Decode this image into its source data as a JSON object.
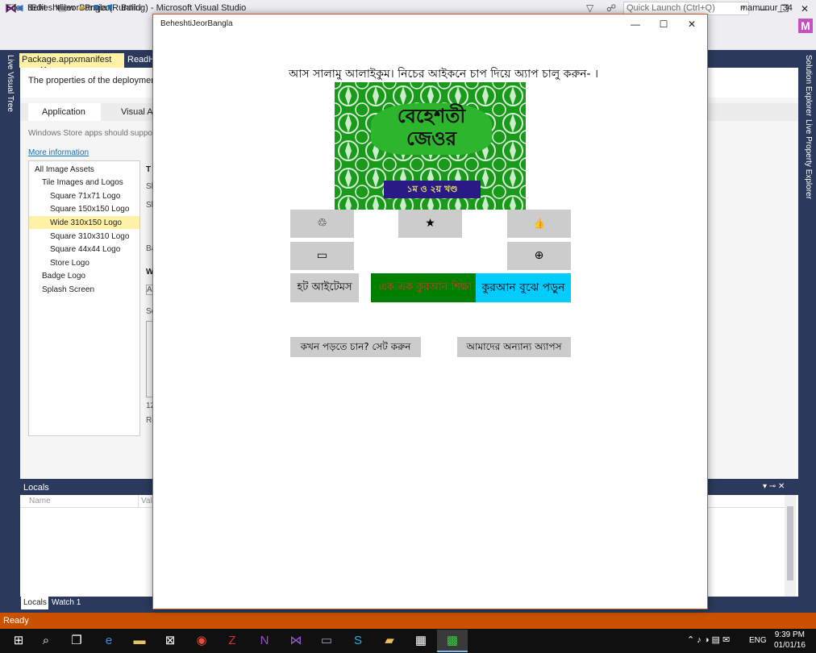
{
  "vs": {
    "title": "BeheshtiJeorBangla (Running) - Microsoft Visual Studio",
    "quick_launch_placeholder": "Quick Launch (Ctrl+Q)",
    "user": "mamunur_34",
    "avatar_letter": "M",
    "menu": [
      "File",
      "Edit",
      "View",
      "Project",
      "Build"
    ],
    "status": "Ready",
    "left_rail": "Live Visual Tree",
    "right_rail": [
      "Solution Explorer",
      "Live Property Explorer"
    ]
  },
  "doc_tabs": {
    "manifest": "Package.appxmanifest",
    "readme": "ReadHa"
  },
  "manifest": {
    "description": "The properties of the deployment pa",
    "tab_application": "Application",
    "tab_visual": "Visual As",
    "info": "Windows Store apps should support c",
    "more_info": "More information",
    "tree": [
      "All Image Assets",
      "Tile Images and Logos",
      "Square 71x71 Logo",
      "Square 150x150 Logo",
      "Wide 310x150 Logo",
      "Square 310x310 Logo",
      "Square 44x44 Logo",
      "Store Logo",
      "Badge Logo",
      "Splash Screen"
    ],
    "side_letters": [
      "T",
      "Sl",
      "Sl",
      "Ba",
      "W",
      "A",
      "Sc",
      "12",
      "Re"
    ]
  },
  "locals": {
    "header": "Locals",
    "col_name": "Name",
    "col_value": "Valu",
    "tab_locals": "Locals",
    "tab_watch": "Watch 1"
  },
  "tray": {
    "lang": "ENG",
    "time": "9:39 PM",
    "date": "01/01/16"
  },
  "app": {
    "title": "BeheshtiJeorBangla",
    "greeting": "আস সালামু আলাইকুম। নিচের আইকনে চাপ দিয়ে অ্যাপ চালু করুন- ।",
    "cover_title_line1": "বেহেশতী",
    "cover_title_line2": "জেওর",
    "cover_volume": "১ম ও ২য় খণ্ড",
    "hot_items": "হট আইটেমস",
    "quran_left": "এক এক কুরআন শিক্ষা",
    "quran_right": "কুরআন বুঝে পড়ুন",
    "schedule": "কখন পড়তে চান? সেট করুন",
    "other_apps": "আমাদের অন্যান্য অ্যাপস",
    "icons": {
      "recycle": "♲",
      "star": "★",
      "like": "👍",
      "video": "▭",
      "globe": "⊕"
    },
    "colors": {
      "quran_left_bg": "#008000",
      "quran_right_bg": "#00ccff",
      "button_bg": "#cccccc"
    }
  }
}
